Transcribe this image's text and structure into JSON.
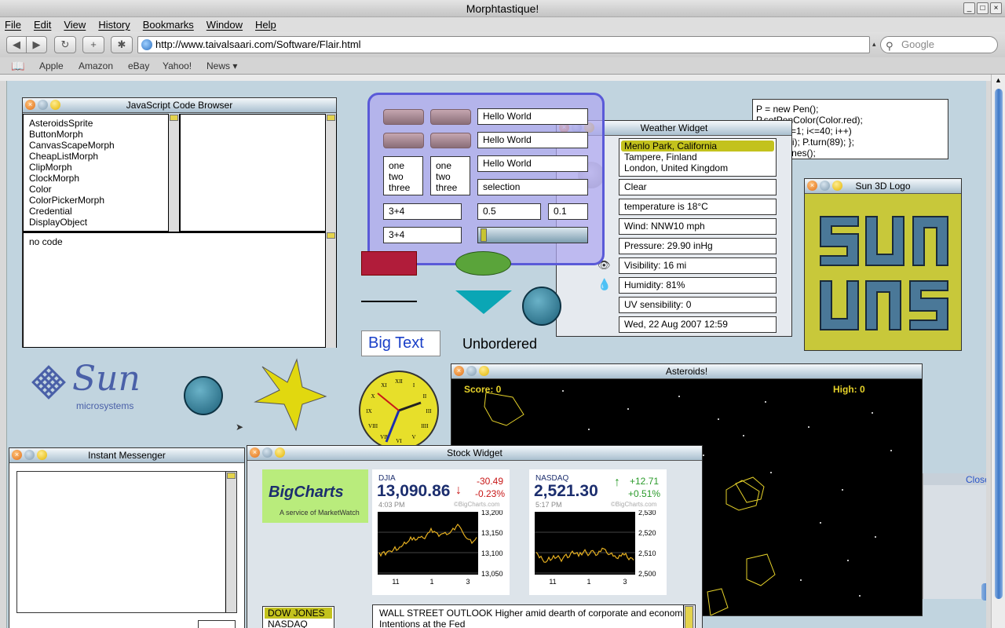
{
  "window": {
    "title": "Morphtastique!",
    "controls": [
      "_",
      "□",
      "×"
    ]
  },
  "menu": [
    "File",
    "Edit",
    "View",
    "History",
    "Bookmarks",
    "Window",
    "Help"
  ],
  "toolbar": {
    "back": "◀",
    "forward": "▶",
    "reload": "↻",
    "add": "+",
    "debug": "✱",
    "url": "http://www.taivalsaari.com/Software/Flair.html",
    "search_placeholder": "Google"
  },
  "bookmarks": [
    "Apple",
    "Amazon",
    "eBay",
    "Yahoo!",
    "News ▾"
  ],
  "code_browser": {
    "title": "JavaScript Code Browser",
    "classes": [
      "AsteroidsSprite",
      "ButtonMorph",
      "CanvasScapeMorph",
      "CheapListMorph",
      "ClipMorph",
      "ClockMorph",
      "Color",
      "ColorPickerMorph",
      "Credential",
      "DisplayObject"
    ],
    "code": "no code"
  },
  "demo_panel": {
    "fields": [
      "Hello World",
      "Hello World",
      "Hello World",
      "selection"
    ],
    "list_items": [
      "one",
      "two",
      "three"
    ],
    "calc1": "3+4",
    "calc2": "3+4",
    "val1": "0.5",
    "val2": "0.1",
    "slider_value": 0.02
  },
  "shapes": {
    "big_text": "Big Text",
    "unbordered": "Unbordered"
  },
  "weather": {
    "title": "Weather Widget",
    "cities": [
      "Menlo Park, California",
      "Tampere, Finland",
      "London, United Kingdom"
    ],
    "selected_city": "Menlo Park, California",
    "clear": "Clear",
    "temperature": "temperature is 18°C",
    "wind": "Wind: NNW10 mph",
    "pressure": "Pressure: 29.90 inHg",
    "visibility": "Visibility: 16 mi",
    "humidity": "Humidity: 81%",
    "uv": "UV sensibility: 0",
    "date": "Wed, 22 Aug 2007 12:59"
  },
  "pen_code": {
    "lines": [
      "P = new Pen();",
      "P.setPenColor(Color.red);",
      "for (var i=1; i<=40; i++)",
      "{ P.go(3*i); P.turn(89); };",
      "P.drawLines();"
    ]
  },
  "sun3d": {
    "title": "Sun 3D Logo",
    "colors": {
      "background": "#c8c83a",
      "letters": "#4a7898"
    }
  },
  "sun_logo": {
    "name": "Sun",
    "tagline": "microsystems"
  },
  "clock": {
    "numerals": [
      "XII",
      "I",
      "II",
      "III",
      "IIII",
      "V",
      "VI",
      "VII",
      "VIII",
      "IX",
      "X",
      "XI"
    ]
  },
  "asteroids": {
    "title": "Asteroids!",
    "score": "Score: 0",
    "high": "High: 0"
  },
  "messenger": {
    "title": "Instant Messenger"
  },
  "hidden_panel": {
    "close": "Close"
  },
  "stock": {
    "title": "Stock Widget",
    "brand": "BigCharts",
    "brand_tag": "A service of MarketWatch",
    "watermark": "©BigCharts.com",
    "djia": {
      "name": "DJIA",
      "value": "13,090.86",
      "change": "-30.49",
      "pct": "-0.23%",
      "time": "4:03 PM",
      "ticks": [
        "13,200",
        "13,150",
        "13,100",
        "13,050"
      ],
      "xticks": [
        "11",
        "1",
        "3"
      ]
    },
    "nasdaq": {
      "name": "NASDAQ",
      "value": "2,521.30",
      "change": "+12.71",
      "pct": "+0.51%",
      "time": "5:17 PM",
      "ticks": [
        "2,530",
        "2,520",
        "2,510",
        "2,500"
      ],
      "xticks": [
        "11",
        "1",
        "3"
      ]
    },
    "index_list": [
      "DOW JONES",
      "NASDAQ"
    ],
    "headline": "WALL STREET OUTLOOK Higher amid dearth of corporate and econom",
    "headline2": "Intentions at the Fed"
  }
}
